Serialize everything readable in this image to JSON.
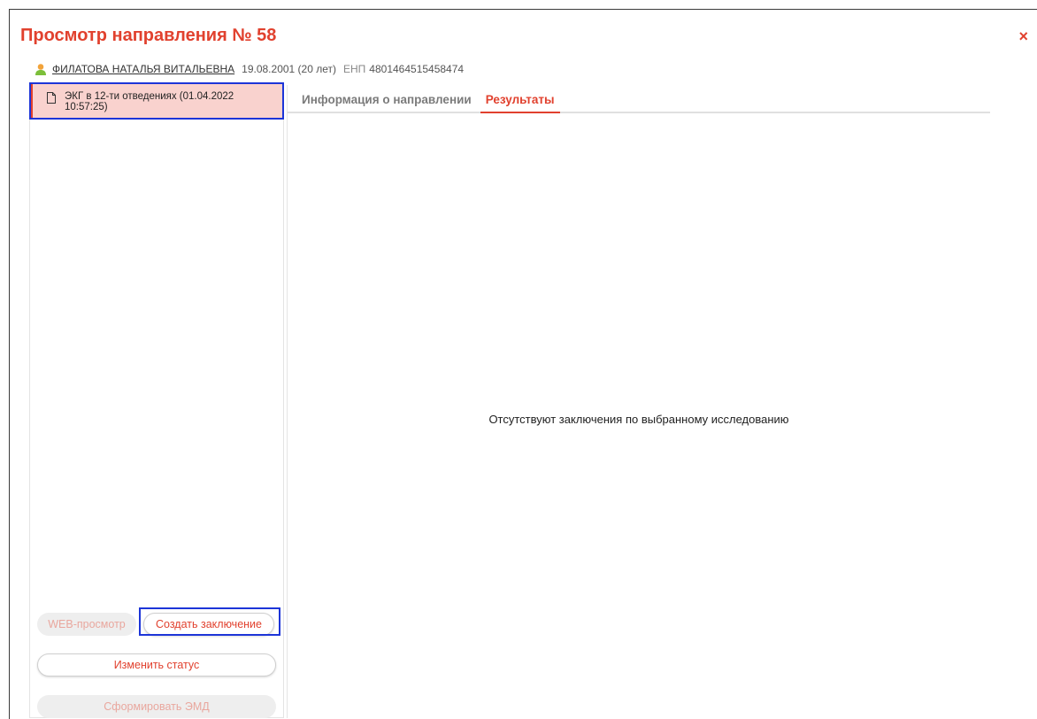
{
  "dialog": {
    "title": "Просмотр направления № 58",
    "close_label": "×"
  },
  "patient": {
    "name": "ФИЛАТОВА НАТАЛЬЯ ВИТАЛЬЕВНА",
    "birth": "19.08.2001 (20 лет)",
    "enp_label": "ЕНП",
    "enp_value": "4801464515458474"
  },
  "exams": [
    {
      "label": "ЭКГ в 12-ти отведениях (01.04.2022 10:57:25)"
    }
  ],
  "buttons": {
    "web_view": "WEB-просмотр",
    "create_conclusion": "Создать заключение",
    "change_status": "Изменить статус",
    "form_emd": "Сформировать ЭМД"
  },
  "tabs": [
    {
      "label": "Информация о направлении"
    },
    {
      "label": "Результаты"
    }
  ],
  "results": {
    "empty_message": "Отсутствуют заключения по выбранному исследованию"
  },
  "colors": {
    "accent": "#e1412e",
    "selected_bg": "#f9d2ce",
    "highlight": "#1d35d8"
  }
}
